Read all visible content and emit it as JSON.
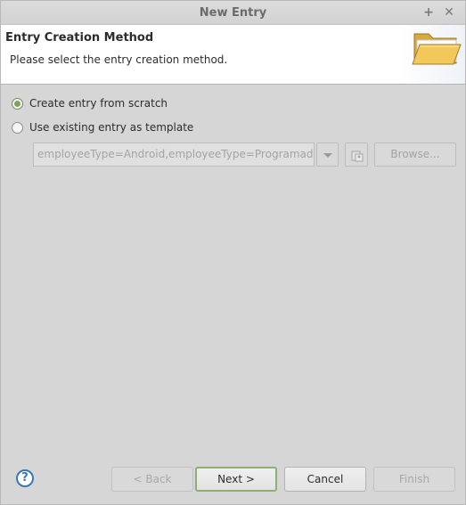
{
  "window": {
    "title": "New Entry",
    "maximize_symbol": "+",
    "close_symbol": "✕"
  },
  "header": {
    "title": "Entry Creation Method",
    "description": "Please select the entry creation method.",
    "icon": "folder-open-icon"
  },
  "options": [
    {
      "label": "Create entry from scratch",
      "selected": true
    },
    {
      "label": "Use existing entry as template",
      "selected": false
    }
  ],
  "template": {
    "value": "employeeType=Android,employeeType=Programadores",
    "browse_label": "Browse...",
    "browse_icon": "ldap-entry-icon"
  },
  "footer": {
    "help_symbol": "?",
    "back_label": "< Back",
    "next_label": "Next >",
    "cancel_label": "Cancel",
    "finish_label": "Finish"
  },
  "colors": {
    "accent_green": "#7fa35f",
    "help_blue": "#3a78b5",
    "folder_yellow": "#f2c85b"
  }
}
